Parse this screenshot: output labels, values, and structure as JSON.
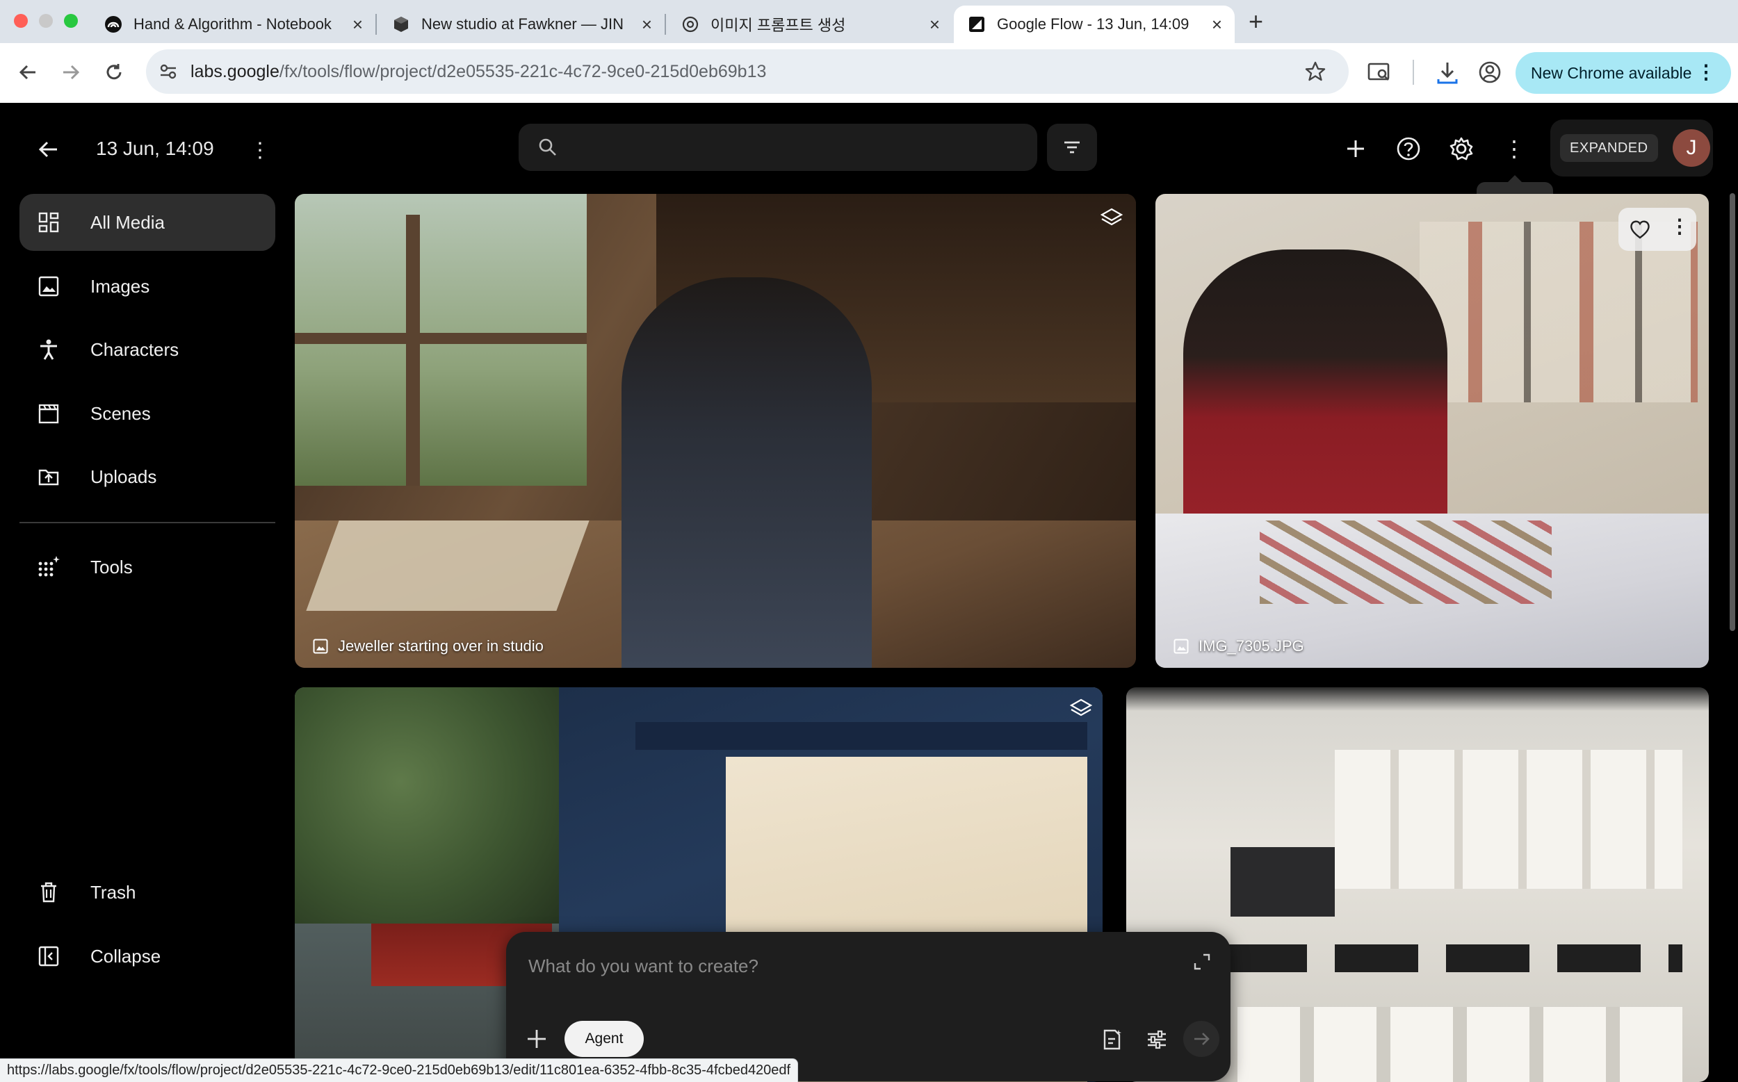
{
  "browser": {
    "tabs": [
      {
        "title": "Hand & Algorithm - Notebook",
        "favicon": "notebooklm-icon"
      },
      {
        "title": "New studio at Fawkner — JIN",
        "favicon": "cube-icon"
      },
      {
        "title": "이미지 프롬프트 생성",
        "favicon": "openai-icon"
      },
      {
        "title": "Google Flow - 13 Jun, 14:09",
        "favicon": "flow-icon",
        "active": true
      }
    ],
    "url_host": "labs.google",
    "url_path": "/fx/tools/flow/project/d2e05535-221c-4c72-9ce0-215d0eb69b13",
    "update_label": "New Chrome available",
    "status_url": "https://labs.google/fx/tools/flow/project/d2e05535-221c-4c72-9ce0-215d0eb69b13/edit/11c801ea-6352-4fbb-8c35-4fcbed420edf"
  },
  "app": {
    "project_title": "13 Jun, 14:09",
    "search_placeholder": "",
    "tooltip": "More",
    "mode_badge": "EXPANDED",
    "avatar_initial": "J",
    "sidebar": {
      "items": [
        {
          "label": "All Media",
          "icon": "grid-icon",
          "active": true
        },
        {
          "label": "Images",
          "icon": "image-icon"
        },
        {
          "label": "Characters",
          "icon": "person-icon"
        },
        {
          "label": "Scenes",
          "icon": "clapperboard-icon"
        },
        {
          "label": "Uploads",
          "icon": "upload-folder-icon"
        }
      ],
      "tools_label": "Tools",
      "trash_label": "Trash",
      "collapse_label": "Collapse"
    },
    "media": [
      {
        "caption": "Jeweller starting over in studio",
        "type": "image"
      },
      {
        "caption": "IMG_7305.JPG",
        "type": "image"
      },
      {
        "caption": "",
        "type": "image"
      },
      {
        "caption": "",
        "type": "image"
      }
    ],
    "prompt": {
      "placeholder": "What do you want to create?",
      "agent_label": "Agent"
    }
  },
  "colors": {
    "accent": "#a8e8f5",
    "background": "#000000",
    "panel": "#1e1e1e"
  }
}
